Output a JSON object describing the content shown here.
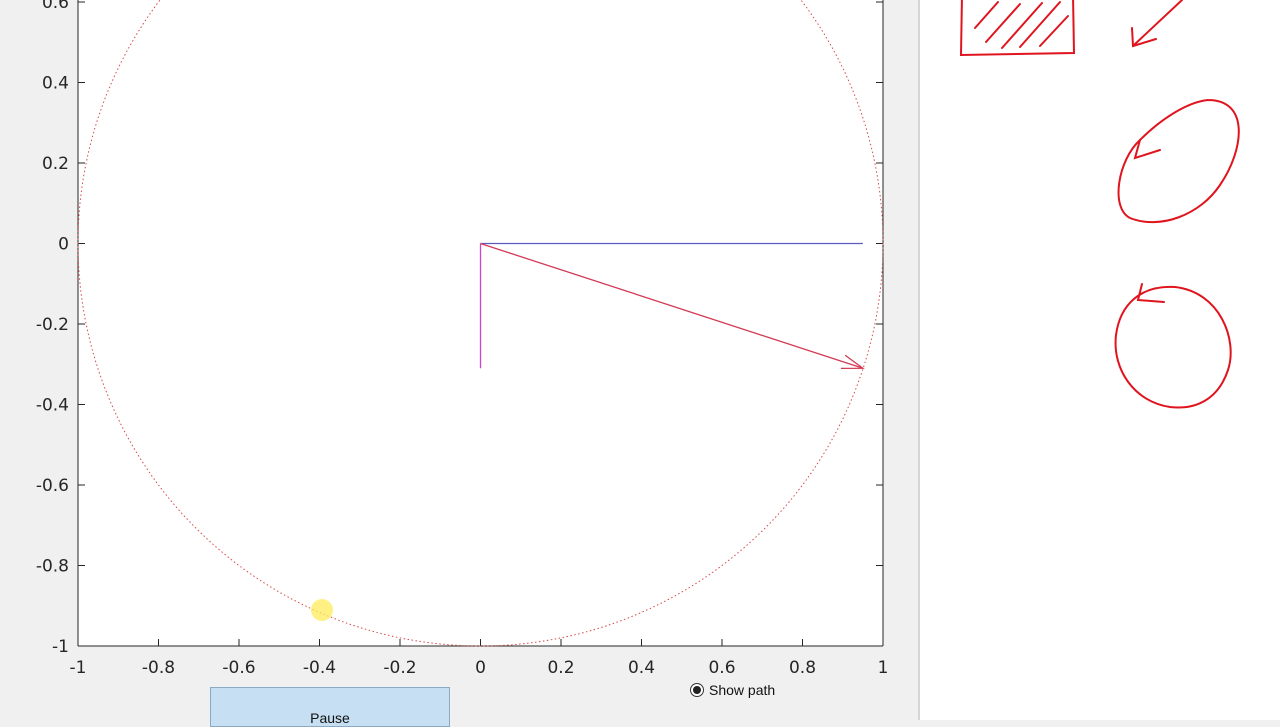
{
  "plot": {
    "x_ticks": [
      "-1",
      "-0.8",
      "-0.6",
      "-0.4",
      "-0.2",
      "0",
      "0.2",
      "0.4",
      "0.6",
      "0.8",
      "1"
    ],
    "y_ticks": [
      "-1",
      "-0.8",
      "-0.6",
      "-0.4",
      "-0.2",
      "0",
      "0.2",
      "0.4",
      "0.6"
    ],
    "xlim": [
      -1,
      1
    ],
    "ylim": [
      -1,
      0.7
    ],
    "circle": {
      "radius": 1,
      "color": "#d94848",
      "style": "dotted"
    },
    "vectors": [
      {
        "name": "horizontal-component",
        "from": [
          0,
          0
        ],
        "to": [
          0.95,
          0
        ],
        "color": "#5b5bc4"
      },
      {
        "name": "vertical-component",
        "from": [
          0,
          0
        ],
        "to": [
          0,
          -0.31
        ],
        "color": "#cc44cc"
      },
      {
        "name": "rotating-vector",
        "from": [
          0,
          0
        ],
        "to": [
          0.95,
          -0.31
        ],
        "color": "#d23a55"
      }
    ]
  },
  "controls": {
    "pause_label": "Pause",
    "show_path_label": "Show path",
    "show_path_checked": true
  },
  "notes": {
    "ink_color": "#e0141e",
    "sketches": [
      "hatched-square",
      "arrow-down-left",
      "clockwise-circle-arrow",
      "circle-arrow"
    ]
  }
}
